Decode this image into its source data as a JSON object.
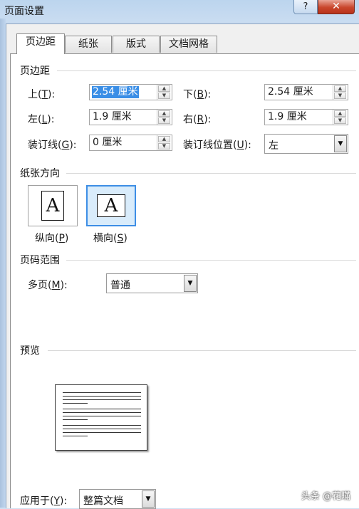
{
  "window": {
    "title": "页面设置",
    "help_label": "?",
    "close_label": "✕"
  },
  "tabs": [
    {
      "label": "页边距"
    },
    {
      "label": "纸张"
    },
    {
      "label": "版式"
    },
    {
      "label": "文档网格"
    }
  ],
  "margins": {
    "section_title": "页边距",
    "top": {
      "label": "上(",
      "key": "T",
      "suffix": "):",
      "value": "2.54 厘米"
    },
    "bottom": {
      "label": "下(",
      "key": "B",
      "suffix": "):",
      "value": "2.54 厘米"
    },
    "left": {
      "label": "左(",
      "key": "L",
      "suffix": "):",
      "value": "1.9 厘米"
    },
    "right": {
      "label": "右(",
      "key": "R",
      "suffix": "):",
      "value": "1.9 厘米"
    },
    "gutter": {
      "label": "装订线(",
      "key": "G",
      "suffix": "):",
      "value": "0 厘米"
    },
    "gutter_pos": {
      "label": "装订线位置(",
      "key": "U",
      "suffix": "):",
      "value": "左"
    }
  },
  "orientation": {
    "section_title": "纸张方向",
    "glyph": "A",
    "portrait": {
      "label": "纵向(",
      "key": "P",
      "suffix": ")"
    },
    "landscape": {
      "label": "横向(",
      "key": "S",
      "suffix": ")"
    },
    "selected": "landscape"
  },
  "pages": {
    "section_title": "页码范围",
    "multiple": {
      "label": "多页(",
      "key": "M",
      "suffix": "):",
      "value": "普通"
    }
  },
  "preview": {
    "section_title": "预览"
  },
  "apply": {
    "label": "应用于(",
    "key": "Y",
    "suffix": "):",
    "value": "整篇文档"
  },
  "watermark": "头条 @花瞞",
  "icons": {
    "spin_up": "spin-up-icon",
    "spin_down": "spin-down-icon",
    "dropdown": "chevron-down-icon",
    "close": "close-icon",
    "help": "help-icon"
  },
  "colors": {
    "selection": "#3a8ee6",
    "close": "#c9462c",
    "selected_border": "#3d8ee5"
  }
}
